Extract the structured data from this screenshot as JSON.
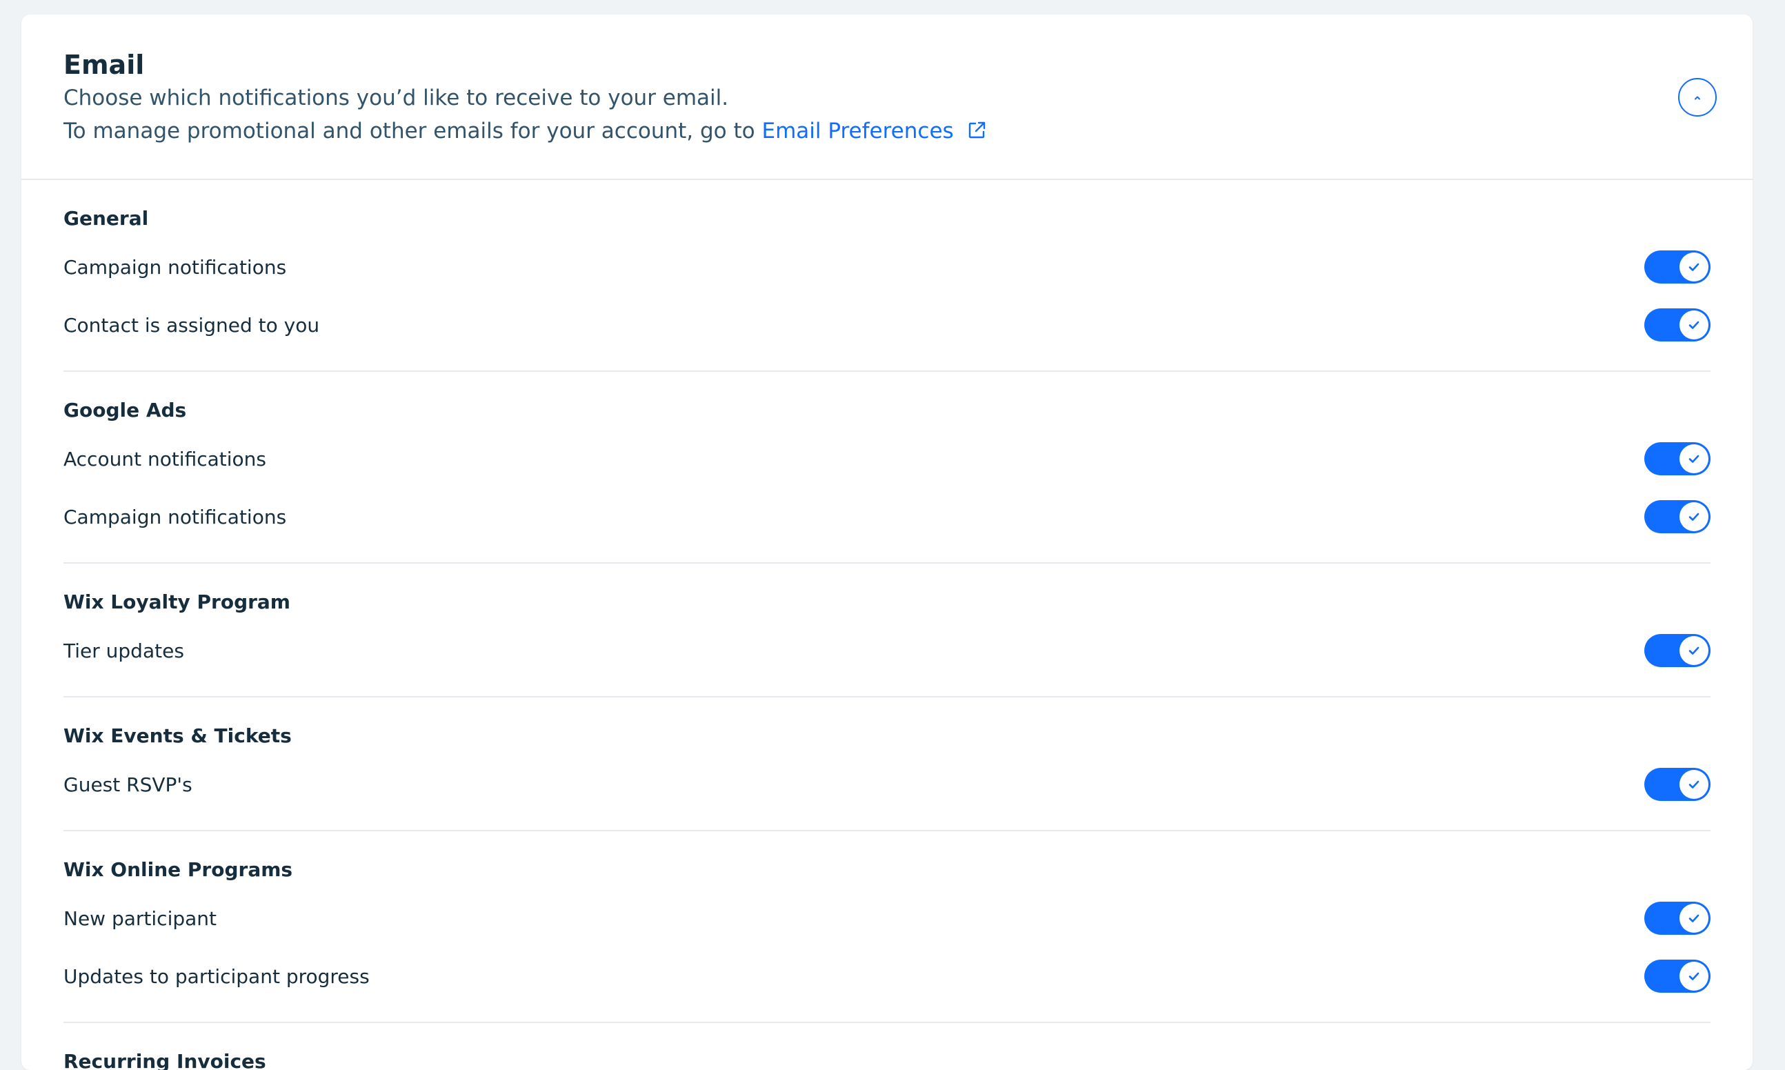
{
  "header": {
    "title": "Email",
    "subtitle": "Choose which notifications you’d like to receive to your email.",
    "manage_prefix": "To manage promotional and other emails for your account, go to ",
    "manage_link": "Email Preferences",
    "link_icon": "external-link-icon",
    "collapse_icon": "chevron-up-icon"
  },
  "colors": {
    "accent": "#116DFF",
    "background": "#F0F3F6",
    "divider": "#E6E9EE",
    "text": "#162D3D"
  },
  "sections": [
    {
      "title": "General",
      "items": [
        {
          "label": "Campaign notifications",
          "enabled": true
        },
        {
          "label": "Contact is assigned to you",
          "enabled": true
        }
      ]
    },
    {
      "title": "Google Ads",
      "items": [
        {
          "label": "Account notifications",
          "enabled": true
        },
        {
          "label": "Campaign notifications",
          "enabled": true
        }
      ]
    },
    {
      "title": "Wix Loyalty Program",
      "items": [
        {
          "label": "Tier updates",
          "enabled": true
        }
      ]
    },
    {
      "title": "Wix Events & Tickets",
      "items": [
        {
          "label": "Guest RSVP's",
          "enabled": true
        }
      ]
    },
    {
      "title": "Wix Online Programs",
      "items": [
        {
          "label": "New participant",
          "enabled": true
        },
        {
          "label": "Updates to participant progress",
          "enabled": true
        }
      ]
    }
  ],
  "next_section_title": "Recurring Invoices"
}
